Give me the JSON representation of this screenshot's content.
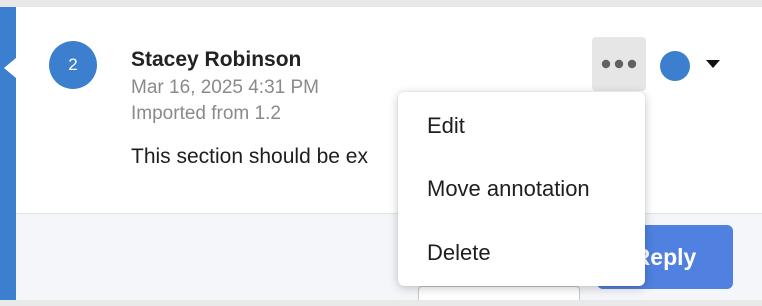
{
  "comment": {
    "number": "2",
    "author": "Stacey Robinson",
    "timestamp": "Mar 16, 2025 4:31 PM",
    "source": "Imported from 1.2",
    "body": "This section should be ex"
  },
  "actions": {
    "more_icon": "more-horizontal-icon",
    "color": "#3d7fcf",
    "caret_icon": "caret-down-icon"
  },
  "menu": {
    "items": [
      "Edit",
      "Move annotation",
      "Delete"
    ]
  },
  "footer": {
    "reply_label": "Reply"
  },
  "colors": {
    "accent": "#3d7fcf",
    "reply_button": "#5081e0"
  }
}
